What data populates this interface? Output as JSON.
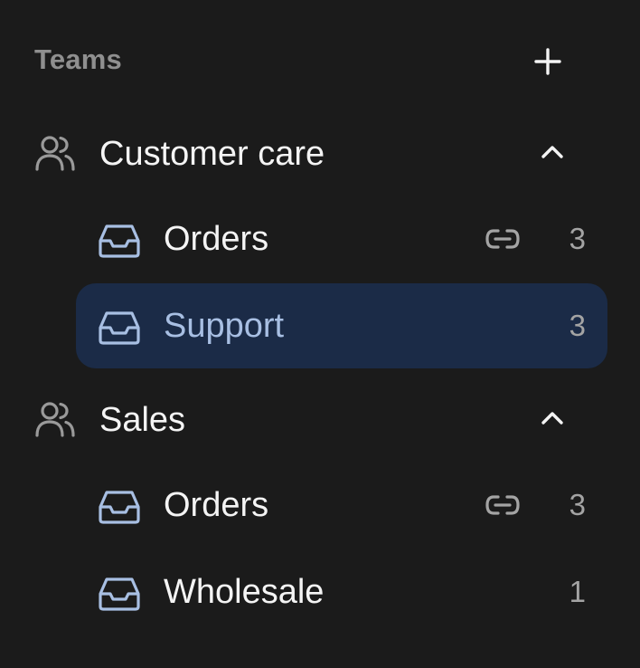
{
  "header": {
    "title": "Teams"
  },
  "teams": [
    {
      "name": "Customer care",
      "inboxes": [
        {
          "name": "Orders",
          "count": "3",
          "linked": true,
          "active": false
        },
        {
          "name": "Support",
          "count": "3",
          "linked": false,
          "active": true
        }
      ]
    },
    {
      "name": "Sales",
      "inboxes": [
        {
          "name": "Orders",
          "count": "3",
          "linked": true,
          "active": false
        },
        {
          "name": "Wholesale",
          "count": "1",
          "linked": false,
          "active": false
        }
      ]
    }
  ],
  "colors": {
    "background": "#1b1b1b",
    "active_row": "#1b2b47",
    "active_text": "#a8bfe3",
    "inbox_icon": "#a8bfe3",
    "muted": "#8f8f8f"
  },
  "icons": {
    "add": "plus-icon",
    "team": "users-icon",
    "collapse": "chevron-up-icon",
    "inbox": "inbox-tray-icon",
    "link": "link-icon"
  }
}
